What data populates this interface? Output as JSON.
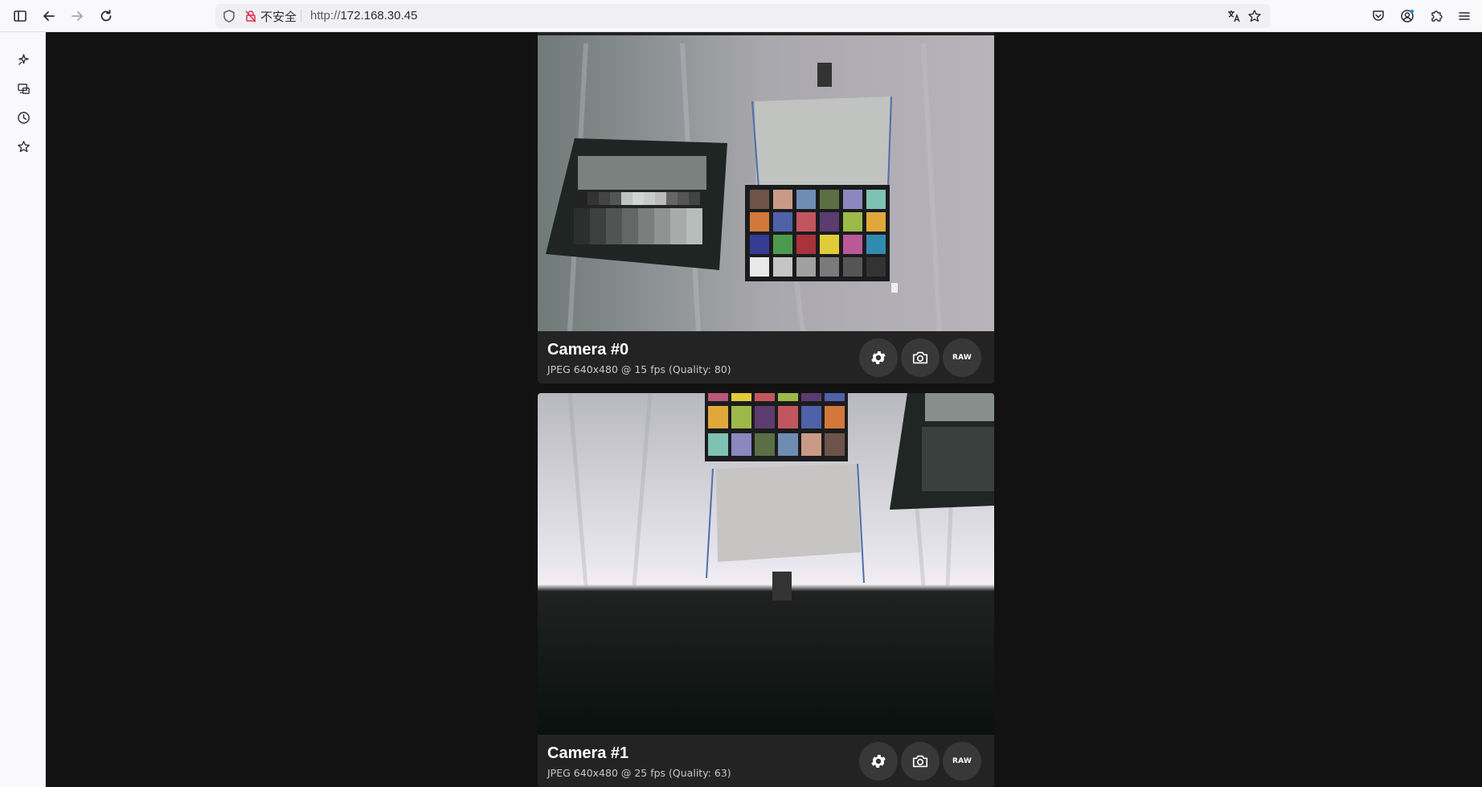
{
  "browser": {
    "security_label": "不安全",
    "url_scheme": "http://",
    "url_host": "172.168.30.45"
  },
  "cameras": [
    {
      "name": "Camera #0",
      "description": "JPEG 640x480 @ 15 fps (Quality: 80)",
      "raw_label": "RAW"
    },
    {
      "name": "Camera #1",
      "description": "JPEG 640x480 @ 25 fps (Quality: 63)",
      "raw_label": "RAW"
    }
  ],
  "colors": {
    "page_background": "#121212",
    "card_info_background": "#232323",
    "button_background": "#383838",
    "browser_chrome": "#f9f9fb"
  },
  "icons": {
    "toolbar": [
      "sidebar-toggle-icon",
      "back-icon",
      "forward-icon",
      "reload-icon",
      "shield-icon",
      "insecure-lock-icon",
      "translate-icon",
      "bookmark-star-icon",
      "pocket-icon",
      "account-icon",
      "extensions-icon",
      "menu-icon"
    ],
    "sidebar": [
      "ai-chat-icon",
      "synced-tabs-icon",
      "history-icon",
      "bookmarks-icon"
    ],
    "card": [
      "gear-icon",
      "camera-icon"
    ]
  }
}
